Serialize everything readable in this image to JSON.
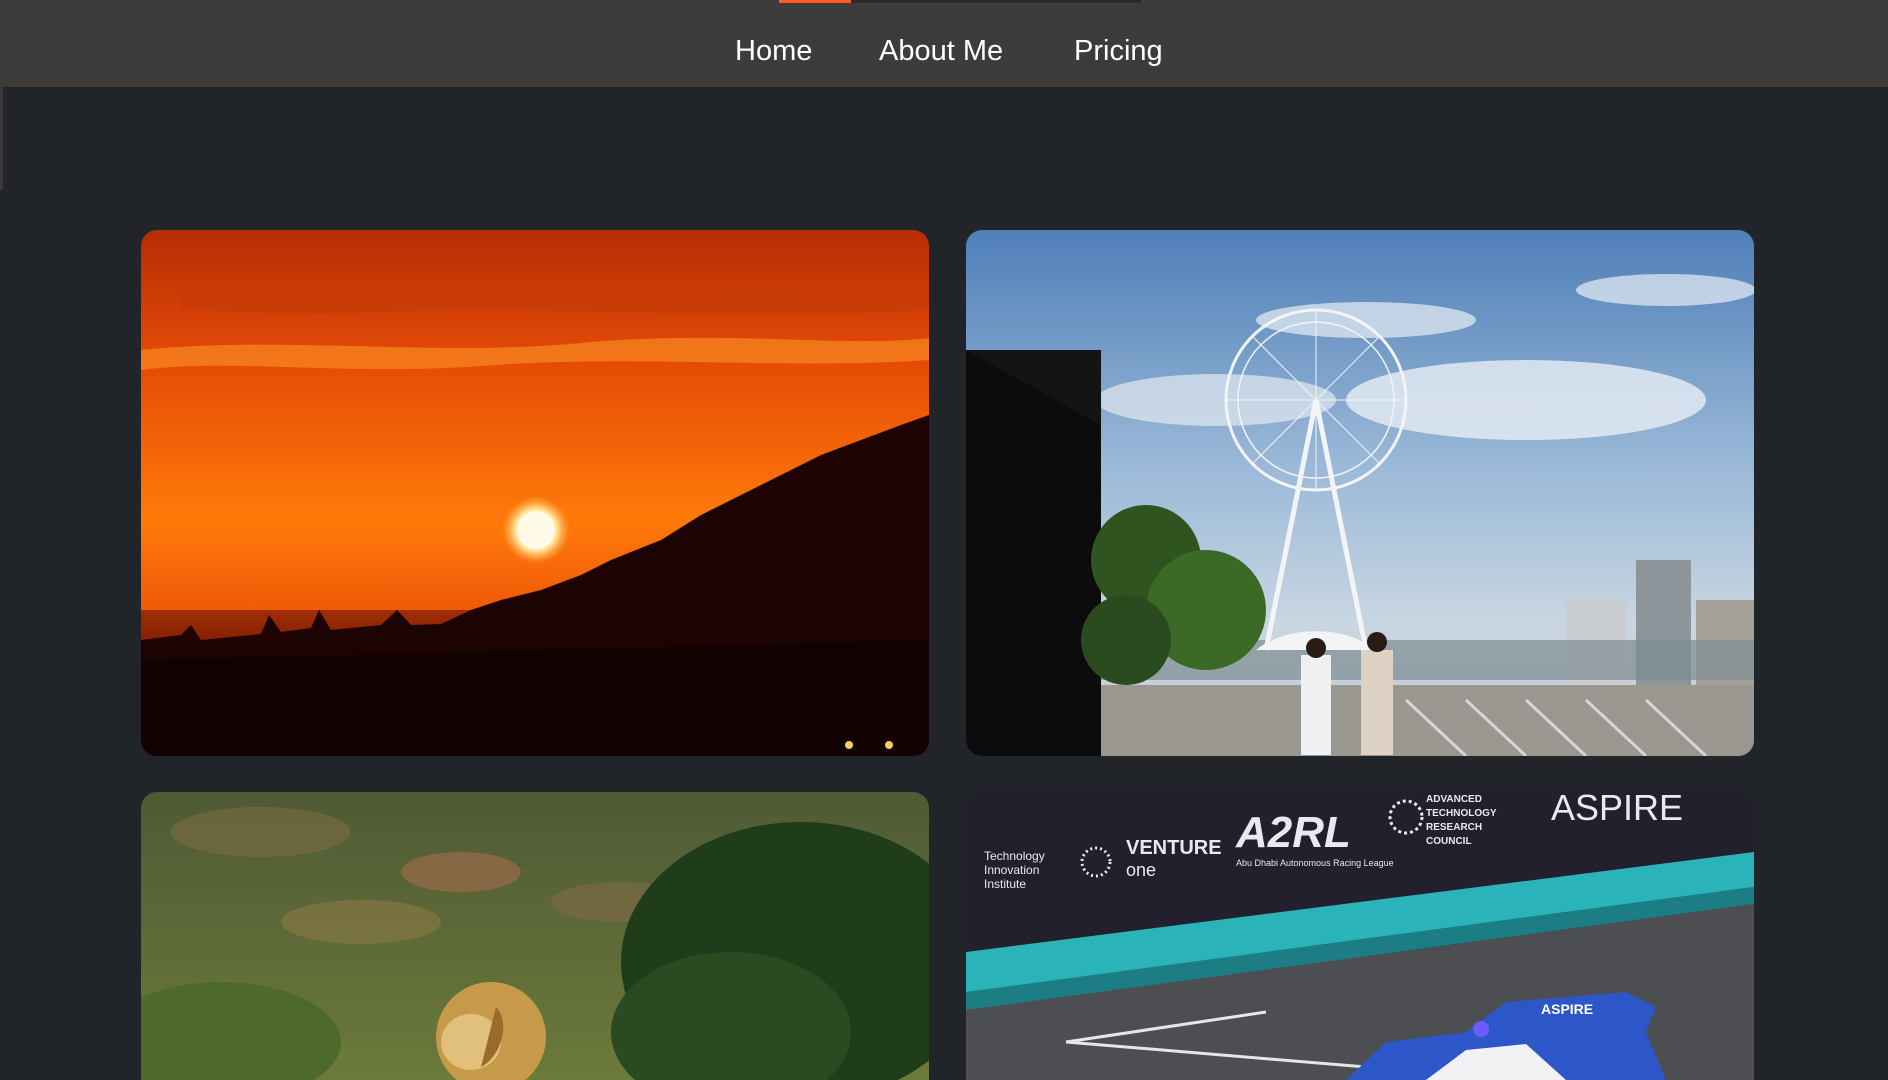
{
  "nav": {
    "items": [
      {
        "label": "Home"
      },
      {
        "label": "About Me"
      },
      {
        "label": "Pricing"
      }
    ],
    "scroll_progress": 0.2
  },
  "gallery": {
    "photos": [
      {
        "subject": "sunset"
      },
      {
        "subject": "ferris-wheel"
      },
      {
        "subject": "lion"
      },
      {
        "subject": "race-car"
      }
    ],
    "race_banner": {
      "sponsor1": "VENTURE",
      "sponsor1_sub": "one",
      "sponsor2": "A2RL",
      "sponsor2_sub": "Abu Dhabi Autonomous Racing League",
      "sponsor3_l1": "ADVANCED",
      "sponsor3_l2": "TECHNOLOGY",
      "sponsor3_l3": "RESEARCH",
      "sponsor3_l4": "COUNCIL",
      "sponsor4": "ASPIRE",
      "sponsor5_l1": "Technology",
      "sponsor5_l2": "Innovation",
      "sponsor5_l3": "Institute",
      "car_label": "ASPIRE"
    }
  },
  "colors": {
    "accent": "#ff5a1f",
    "nav_bg": "#3e3b3b",
    "page_bg": "#212428"
  }
}
